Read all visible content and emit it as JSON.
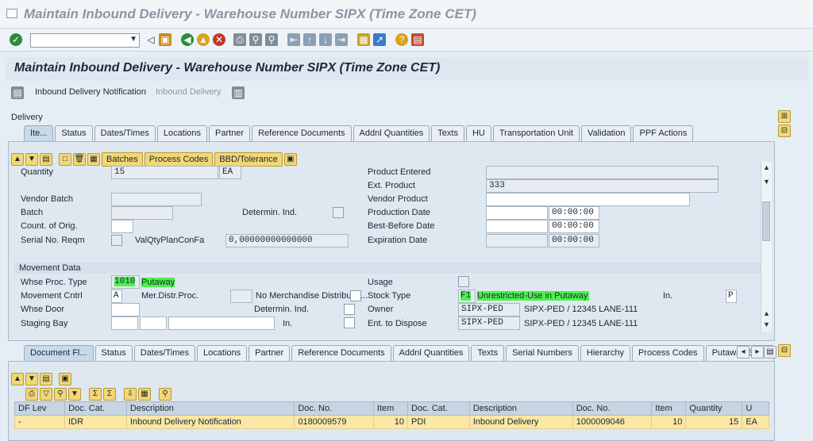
{
  "window_title": "Maintain Inbound Delivery - Warehouse Number SIPX (Time Zone CET)",
  "screen_title": "Maintain Inbound Delivery - Warehouse Number SIPX (Time Zone CET)",
  "app_toolbar": {
    "notification": "Inbound Delivery Notification",
    "delivery": "Inbound Delivery"
  },
  "delivery_label": "Delivery",
  "item_tabs": [
    "Ite...",
    "Status",
    "Dates/Times",
    "Locations",
    "Partner",
    "Reference Documents",
    "Addnl Quantities",
    "Texts",
    "HU",
    "Transportation Unit",
    "Validation",
    "PPF Actions"
  ],
  "item_toolbar": {
    "batches": "Batches",
    "process_codes": "Process Codes",
    "bbd_tolerance": "BBD/Tolerance"
  },
  "item_fields": {
    "quantity_label": "Quantity",
    "quantity_value": "15",
    "quantity_uom": "EA",
    "product_entered_label": "Product Entered",
    "product_entered_value": "",
    "ext_product_label": "Ext. Product",
    "ext_product_value": "333",
    "vendor_batch_label": "Vendor Batch",
    "vendor_product_label": "Vendor Product",
    "batch_label": "Batch",
    "determin_ind_label": "Determin. Ind.",
    "production_date_label": "Production Date",
    "production_time": "00:00:00",
    "count_orig_label": "Count. of Orig.",
    "best_before_label": "Best-Before Date",
    "best_before_time": "00:00:00",
    "serial_no_label": "Serial No. Reqm",
    "valqty_label": "ValQtyPlanConFa",
    "valqty_value": "0,00000000000000",
    "expiration_label": "Expiration Date",
    "expiration_time": "00:00:00"
  },
  "movement": {
    "header": "Movement Data",
    "whse_proc_label": "Whse Proc. Type",
    "whse_proc_value": "1010",
    "whse_proc_desc": "Putaway",
    "usage_label": "Usage",
    "movement_cntrl_label": "Movement Cntrl",
    "movement_cntrl_value": "A",
    "mer_distr_label": "Mer.Distr.Proc.",
    "no_merch_label": "No Merchandise Distributio...",
    "stock_type_label": "Stock Type",
    "stock_type_value": "F1",
    "stock_type_desc": "Unrestricted-Use in Putaway",
    "in_label": "In.",
    "in_value": "P",
    "whse_door_label": "Whse Door",
    "determin_ind_label": "Determin. Ind.",
    "owner_label": "Owner",
    "owner_value": "SIPX-PED",
    "owner_desc": "SIPX-PED / 12345 LANE-111",
    "staging_bay_label": "Staging Bay",
    "in2_label": "In.",
    "ent_dispose_label": "Ent. to Dispose",
    "ent_dispose_value": "SIPX-PED",
    "ent_dispose_desc": "SIPX-PED / 12345 LANE-111"
  },
  "doc_tabs": [
    "Document Fl...",
    "Status",
    "Dates/Times",
    "Locations",
    "Partner",
    "Reference Documents",
    "Addnl Quantities",
    "Texts",
    "Serial Numbers",
    "Hierarchy",
    "Process Codes",
    "Putaway Bin..."
  ],
  "doc_table": {
    "headers": [
      "DF Lev",
      "Doc. Cat.",
      "Description",
      "Doc. No.",
      "Item",
      "Doc. Cat.",
      "Description",
      "Doc. No.",
      "Item",
      "Quantity",
      "U"
    ],
    "rows": [
      [
        "-",
        "IDR",
        "Inbound Delivery Notification",
        "0180009579",
        "10",
        "PDI",
        "Inbound Delivery",
        "1000009046",
        "10",
        "15",
        "EA"
      ]
    ]
  },
  "colors": {
    "highlight": "#4cf24c",
    "panel_bg": "#dfe8f0",
    "row_highlight": "#fbe7a6"
  }
}
